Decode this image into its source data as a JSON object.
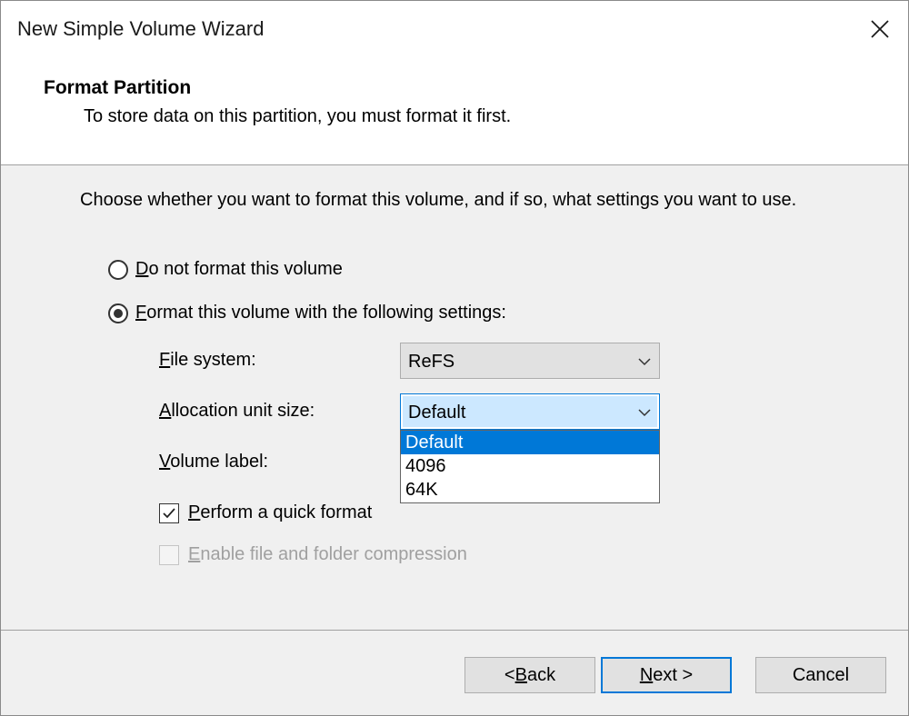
{
  "window": {
    "title": "New Simple Volume Wizard"
  },
  "header": {
    "title": "Format Partition",
    "subtitle": "To store data on this partition, you must format it first."
  },
  "body": {
    "intro": "Choose whether you want to format this volume, and if so, what settings you want to use.",
    "option_no_format": {
      "mnemonic": "D",
      "rest": "o not format this volume",
      "checked": false
    },
    "option_format": {
      "mnemonic": "F",
      "rest": "ormat this volume with the following settings:",
      "checked": true
    },
    "file_system": {
      "label_mnemonic": "F",
      "label_rest": "ile system:",
      "value": "ReFS"
    },
    "allocation_unit": {
      "label_mnemonic": "A",
      "label_rest": "llocation unit size:",
      "value": "Default",
      "options": [
        "Default",
        "4096",
        "64K"
      ]
    },
    "volume_label": {
      "label_mnemonic": "V",
      "label_rest": "olume label:"
    },
    "quick_format": {
      "mnemonic": "P",
      "rest": "erform a quick format",
      "checked": true
    },
    "compression": {
      "mnemonic": "E",
      "rest": "nable file and folder compression",
      "checked": false,
      "enabled": false
    }
  },
  "footer": {
    "back": {
      "prefix": "< ",
      "mnemonic": "B",
      "rest": "ack"
    },
    "next": {
      "mnemonic": "N",
      "rest": "ext >"
    },
    "cancel": "Cancel"
  },
  "colors": {
    "accent": "#0078d7",
    "highlight": "#cce8ff"
  }
}
